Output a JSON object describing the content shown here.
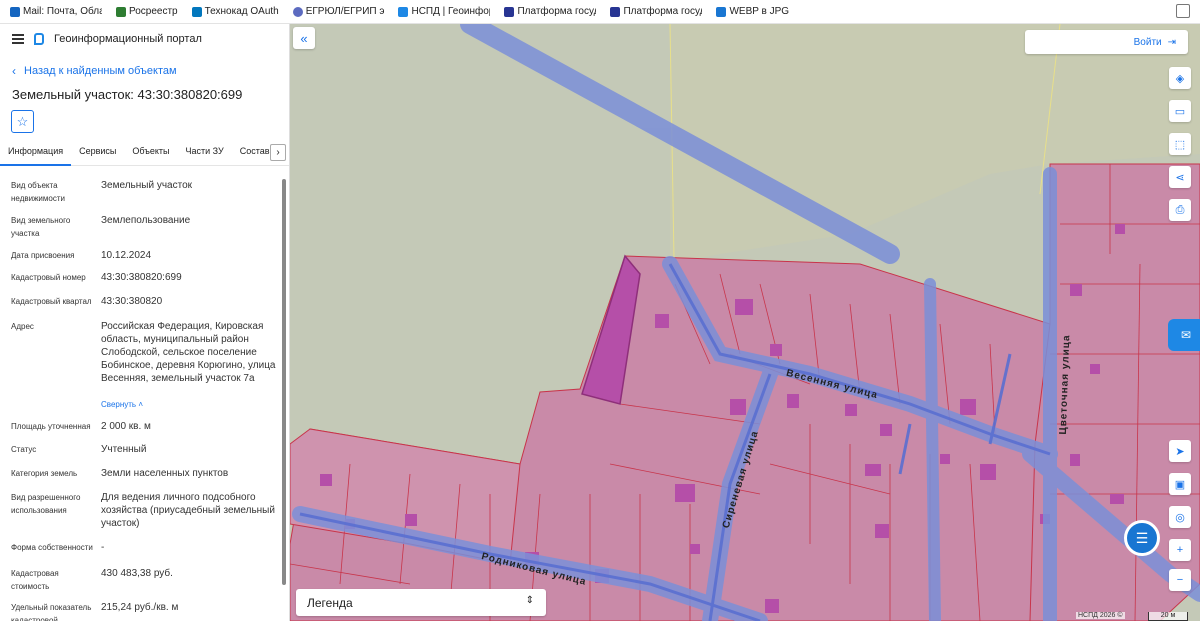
{
  "bookmarks": [
    {
      "label": "Mail: Почта, Обла",
      "color": "#1565c0"
    },
    {
      "label": "Росреестр",
      "color": "#2e7d32"
    },
    {
      "label": "Технокад OAuth",
      "color": "#0277bd"
    },
    {
      "label": "ЕГРЮЛ/ЕГРИП э",
      "color": "#5c6bc0"
    },
    {
      "label": "НСПД | Геоинфор",
      "color": "#1e88e5"
    },
    {
      "label": "Платформа госуд",
      "color": "#283593"
    },
    {
      "label": "Платформа госуд",
      "color": "#283593"
    },
    {
      "label": "WEBP в JPG",
      "color": "#1976d2"
    }
  ],
  "header": {
    "title": "Геоинформационный портал"
  },
  "back_link": "Назад к найденным объектам",
  "object_title": "Земельный участок: 43:30:380820:699",
  "tabs": [
    "Информация",
    "Сервисы",
    "Объекты",
    "Части ЗУ",
    "Состав"
  ],
  "tab_next": "›",
  "properties": [
    {
      "key": "Вид объекта недвижимости",
      "value": "Земельный участок"
    },
    {
      "key": "Вид земельного участка",
      "value": "Землепользование"
    },
    {
      "key": "Дата присвоения",
      "value": "10.12.2024"
    },
    {
      "key": "Кадастровый номер",
      "value": "43:30:380820:699"
    },
    {
      "key": "Кадастровый квартал",
      "value": "43:30:380820"
    },
    {
      "key": "Адрес",
      "value": "Российская Федерация, Кировская область, муниципальный район Слободской, сельское поселение Бобинское, деревня Корюгино, улица Весенняя, земельный участок 7а"
    },
    {
      "key": "Площадь уточненная",
      "value": "2 000 кв. м"
    },
    {
      "key": "Статус",
      "value": "Учтенный"
    },
    {
      "key": "Категория земель",
      "value": "Земли населенных пунктов"
    },
    {
      "key": "Вид разрешенного использования",
      "value": "Для ведения личного подсобного хозяйства (приусадебный земельный участок)"
    },
    {
      "key": "Форма собственности",
      "value": "-"
    },
    {
      "key": "Кадастровая стоимость",
      "value": "430 483,38 руб."
    },
    {
      "key": "Удельный показатель кадастровой",
      "value": "215,24 руб./кв. м"
    }
  ],
  "collapse_label": "Свернуть",
  "map": {
    "login_label": "Войти",
    "legend_label": "Легенда",
    "attribution": "НСПД 2026 ©",
    "scale_label": "20 м",
    "streets": {
      "vesennyaya": "Весенняя улица",
      "sirenevaya": "Сиреневая улица",
      "rodnikovaya": "Родниковая улица",
      "tsvetochnaya": "Цветочная улица"
    },
    "colors": {
      "parcel_fill": "#c98aa8",
      "parcel_stroke": "#c8344a",
      "road": "#7b8fd8",
      "selected": "#b54fa8",
      "background": "#c4c9b7"
    }
  }
}
